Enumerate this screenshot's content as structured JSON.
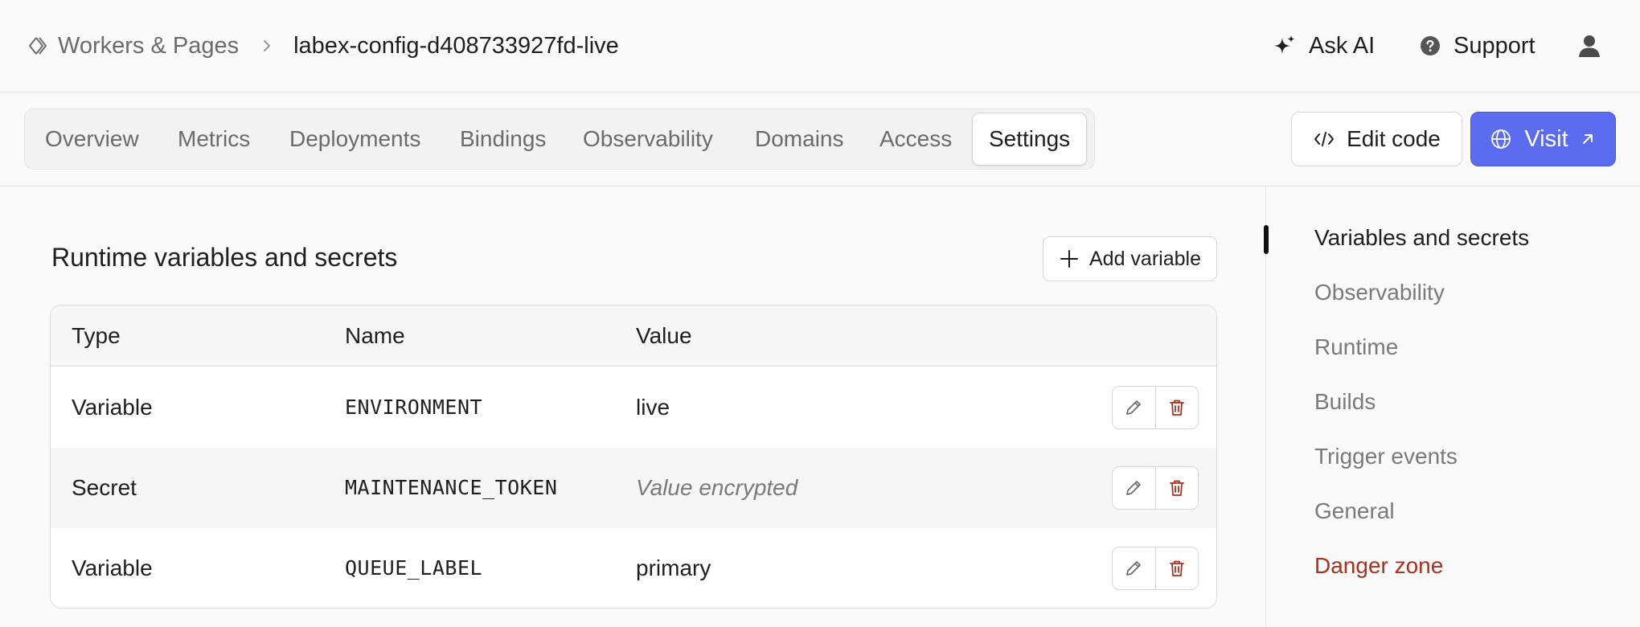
{
  "breadcrumb": {
    "root": "Workers & Pages",
    "current": "labex-config-d408733927fd-live"
  },
  "header": {
    "ask_ai": "Ask AI",
    "support": "Support"
  },
  "tabs": [
    {
      "label": "Overview"
    },
    {
      "label": "Metrics"
    },
    {
      "label": "Deployments"
    },
    {
      "label": "Bindings"
    },
    {
      "label": "Observability"
    },
    {
      "label": "Domains"
    },
    {
      "label": "Access"
    },
    {
      "label": "Settings",
      "active": true
    }
  ],
  "actions": {
    "edit_code": "Edit code",
    "visit": "Visit"
  },
  "section": {
    "title": "Runtime variables and secrets",
    "add_button": "Add variable"
  },
  "table": {
    "columns": [
      "Type",
      "Name",
      "Value"
    ],
    "rows": [
      {
        "type": "Variable",
        "name": "ENVIRONMENT",
        "value": "live"
      },
      {
        "type": "Secret",
        "name": "MAINTENANCE_TOKEN",
        "value": "Value encrypted"
      },
      {
        "type": "Variable",
        "name": "QUEUE_LABEL",
        "value": "primary"
      }
    ]
  },
  "sidenav": {
    "items": [
      {
        "label": "Variables and secrets",
        "active": true
      },
      {
        "label": "Observability"
      },
      {
        "label": "Runtime"
      },
      {
        "label": "Builds"
      },
      {
        "label": "Trigger events"
      },
      {
        "label": "General"
      },
      {
        "label": "Danger zone",
        "danger": true
      }
    ]
  },
  "colors": {
    "accent": "#5b6cf0",
    "danger": "#a8321f",
    "background": "#fafafa"
  },
  "icons": [
    "workers-icon",
    "chevron-right-icon",
    "sparkle-icon",
    "help-circle-icon",
    "user-icon",
    "code-icon",
    "globe-icon",
    "arrow-up-right-icon",
    "plus-icon",
    "pencil-icon",
    "trash-icon"
  ]
}
